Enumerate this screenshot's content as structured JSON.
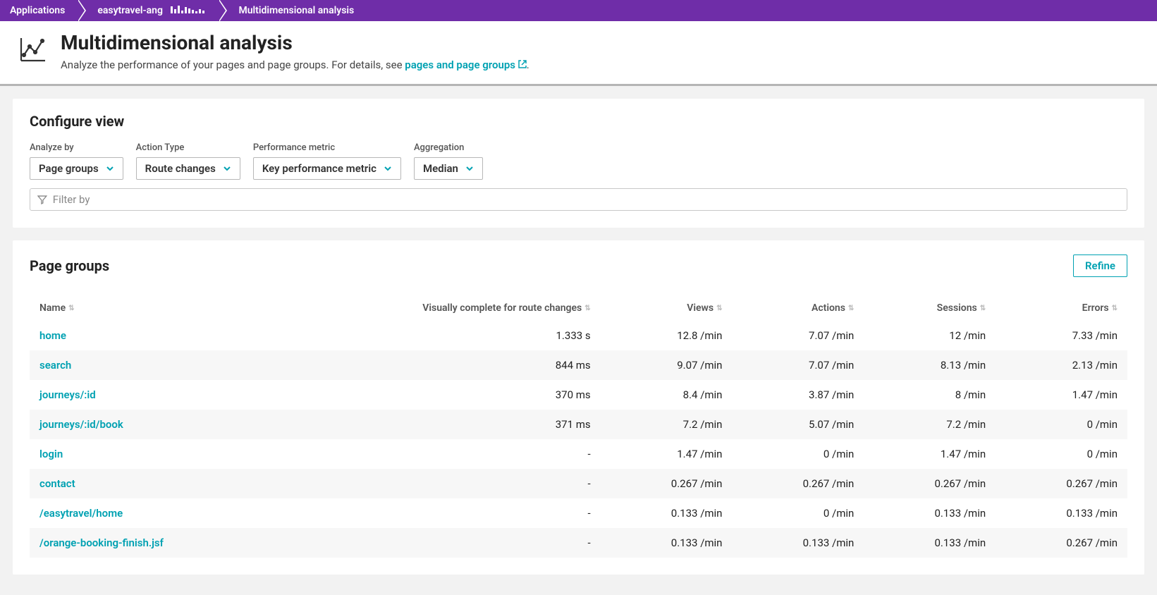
{
  "breadcrumb": {
    "root": "Applications",
    "app": "easytravel-ang",
    "current": "Multidimensional analysis"
  },
  "header": {
    "title": "Multidimensional analysis",
    "subtitle_pre": "Analyze the performance of your pages and page groups. For details, see ",
    "link_text": "pages and page groups",
    "subtitle_post": "."
  },
  "configure": {
    "title": "Configure view",
    "analyze_by": {
      "label": "Analyze by",
      "value": "Page groups"
    },
    "action_type": {
      "label": "Action Type",
      "value": "Route changes"
    },
    "perf_metric": {
      "label": "Performance metric",
      "value": "Key performance metric"
    },
    "aggregation": {
      "label": "Aggregation",
      "value": "Median"
    },
    "filter_placeholder": "Filter by"
  },
  "results": {
    "title": "Page groups",
    "refine": "Refine",
    "columns": {
      "name": "Name",
      "vc": "Visually complete for route changes",
      "views": "Views",
      "actions": "Actions",
      "sessions": "Sessions",
      "errors": "Errors"
    },
    "rows": [
      {
        "name": "home",
        "vc": "1.333 s",
        "views": "12.8 /min",
        "actions": "7.07 /min",
        "sessions": "12 /min",
        "errors": "7.33 /min"
      },
      {
        "name": "search",
        "vc": "844 ms",
        "views": "9.07 /min",
        "actions": "7.07 /min",
        "sessions": "8.13 /min",
        "errors": "2.13 /min"
      },
      {
        "name": "journeys/:id",
        "vc": "370 ms",
        "views": "8.4 /min",
        "actions": "3.87 /min",
        "sessions": "8 /min",
        "errors": "1.47 /min"
      },
      {
        "name": "journeys/:id/book",
        "vc": "371 ms",
        "views": "7.2 /min",
        "actions": "5.07 /min",
        "sessions": "7.2 /min",
        "errors": "0 /min"
      },
      {
        "name": "login",
        "vc": "-",
        "views": "1.47 /min",
        "actions": "0 /min",
        "sessions": "1.47 /min",
        "errors": "0 /min"
      },
      {
        "name": "contact",
        "vc": "-",
        "views": "0.267 /min",
        "actions": "0.267 /min",
        "sessions": "0.267 /min",
        "errors": "0.267 /min"
      },
      {
        "name": "/easytravel/home",
        "vc": "-",
        "views": "0.133 /min",
        "actions": "0 /min",
        "sessions": "0.133 /min",
        "errors": "0.133 /min"
      },
      {
        "name": "/orange-booking-finish.jsf",
        "vc": "-",
        "views": "0.133 /min",
        "actions": "0.133 /min",
        "sessions": "0.133 /min",
        "errors": "0.267 /min"
      }
    ]
  }
}
